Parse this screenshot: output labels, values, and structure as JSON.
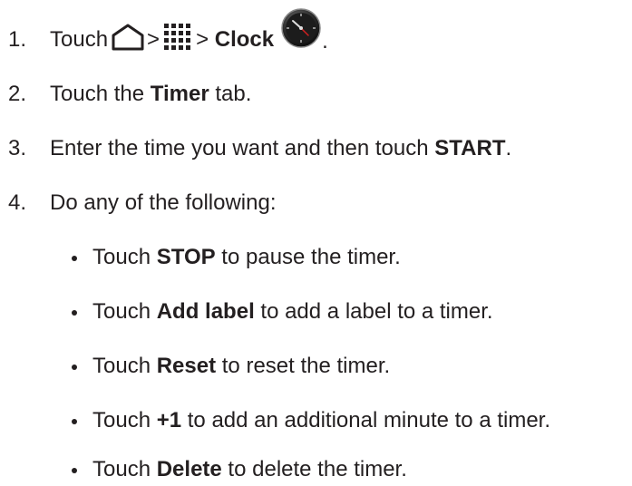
{
  "steps": [
    {
      "number": "1.",
      "prefix": "Touch",
      "sep1": ">",
      "sep2": ">",
      "bold": "Clock",
      "suffix": "."
    },
    {
      "number": "2.",
      "prefix": "Touch the ",
      "bold": "Timer",
      "suffix": " tab."
    },
    {
      "number": "3.",
      "prefix": "Enter the time you want and then touch ",
      "bold": "START",
      "suffix": "."
    },
    {
      "number": "4.",
      "text": "Do any of the following:"
    }
  ],
  "bullets": [
    {
      "prefix": "Touch ",
      "bold": "STOP",
      "suffix": " to pause the timer."
    },
    {
      "prefix": "Touch ",
      "bold": "Add label",
      "suffix": " to add a label to a timer."
    },
    {
      "prefix": "Touch ",
      "bold": "Reset",
      "suffix": " to reset the timer."
    },
    {
      "prefix": "Touch ",
      "bold": "+1",
      "suffix": " to add an additional minute to a timer."
    },
    {
      "prefix": "Touch ",
      "bold": "Delete",
      "suffix": " to delete the timer."
    }
  ],
  "icons": {
    "home": "home-icon",
    "apps": "apps-grid-icon",
    "clock": "clock-app-icon"
  }
}
